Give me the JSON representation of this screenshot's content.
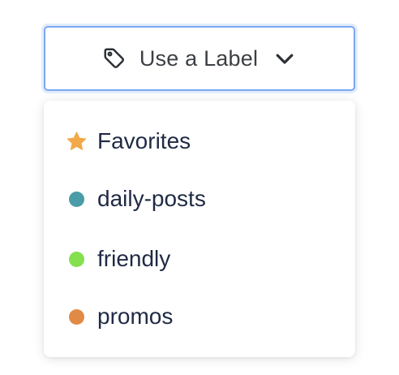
{
  "trigger": {
    "label": "Use a Label",
    "icon": "tag-icon",
    "chevron_icon": "chevron-down-icon"
  },
  "menu": {
    "items": [
      {
        "label": "Favorites",
        "icon": "star-icon",
        "color": "#f2a94a"
      },
      {
        "label": "daily-posts",
        "icon": "dot",
        "color": "#4a9ca8"
      },
      {
        "label": "friendly",
        "icon": "dot",
        "color": "#84e04e"
      },
      {
        "label": "promos",
        "icon": "dot",
        "color": "#e08a46"
      }
    ]
  }
}
